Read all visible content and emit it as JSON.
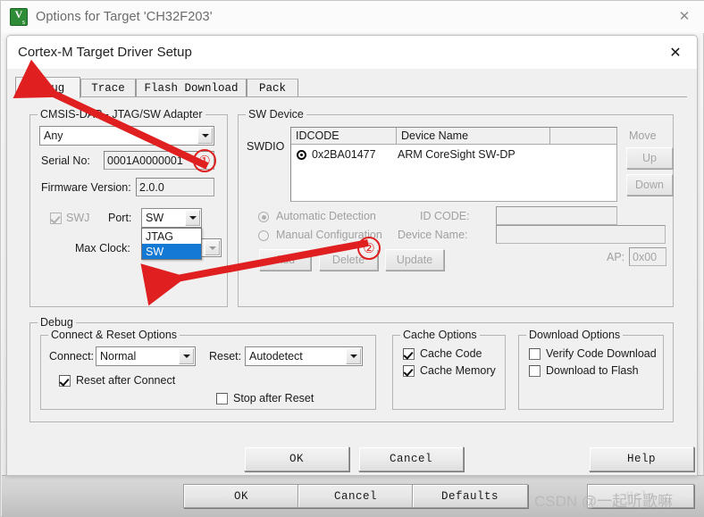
{
  "outer_window": {
    "title": "Options for Target 'CH32F203'",
    "icon": "keil-uvision-icon",
    "close_label": "✕",
    "buttons": [
      {
        "label": "OK"
      },
      {
        "label": "Cancel"
      },
      {
        "label": "Defaults"
      },
      {
        "label": "Help"
      }
    ]
  },
  "dialog": {
    "title": "Cortex-M Target Driver Setup",
    "close_label": "✕",
    "tabs": [
      {
        "label": "Debug",
        "active": true
      },
      {
        "label": "Trace",
        "active": false
      },
      {
        "label": "Flash Download",
        "active": false
      },
      {
        "label": "Pack",
        "active": false
      }
    ],
    "buttons": [
      {
        "label": "OK"
      },
      {
        "label": "Cancel"
      },
      {
        "label": "Help"
      }
    ]
  },
  "adapter": {
    "group_label": "CMSIS-DAP - JTAG/SW Adapter",
    "selected_adapter": "Any",
    "serial_no_label": "Serial No:",
    "serial_no_value": "0001A0000001",
    "firmware_label": "Firmware Version:",
    "firmware_value": "2.0.0",
    "swj_label": "SWJ",
    "swj_checked": true,
    "port_label": "Port:",
    "port_value": "SW",
    "port_options": [
      {
        "label": "JTAG",
        "selected": false
      },
      {
        "label": "SW",
        "selected": true
      }
    ],
    "max_clock_label": "Max Clock:"
  },
  "sw_device": {
    "group_label": "SW Device",
    "swdio_label": "SWDIO",
    "columns": [
      "IDCODE",
      "Device Name",
      ""
    ],
    "rows": [
      {
        "idcode": "0x2BA01477",
        "device_name": "ARM CoreSight SW-DP",
        "selected": true
      }
    ],
    "move_label": "Move",
    "up_label": "Up",
    "down_label": "Down",
    "automatic_detection_label": "Automatic Detection",
    "manual_configuration_label": "Manual Configuration",
    "detection_mode": "automatic",
    "id_code_label": "ID CODE:",
    "id_code_value": "",
    "device_name_label": "Device Name:",
    "device_name_value": "",
    "ap_label": "AP:",
    "ap_value": "0x00",
    "add_label": "Add",
    "delete_label": "Delete",
    "update_label": "Update"
  },
  "debug": {
    "group_label": "Debug",
    "connect_reset": {
      "group_label": "Connect & Reset Options",
      "connect_label": "Connect:",
      "connect_value": "Normal",
      "reset_label": "Reset:",
      "reset_value": "Autodetect",
      "reset_after_connect_label": "Reset after Connect",
      "reset_after_connect_checked": true,
      "stop_after_reset_label": "Stop after Reset",
      "stop_after_reset_checked": false
    },
    "cache_options": {
      "group_label": "Cache Options",
      "cache_code_label": "Cache Code",
      "cache_code_checked": true,
      "cache_memory_label": "Cache Memory",
      "cache_memory_checked": true
    },
    "download_options": {
      "group_label": "Download Options",
      "verify_code_download_label": "Verify Code Download",
      "verify_code_download_checked": false,
      "download_to_flash_label": "Download to Flash",
      "download_to_flash_checked": false
    }
  },
  "annotations": {
    "marker_one": "①",
    "marker_two": "②",
    "accent_color": "#e02020"
  },
  "watermark": {
    "text": "CSDN @一起听歌嘛"
  }
}
